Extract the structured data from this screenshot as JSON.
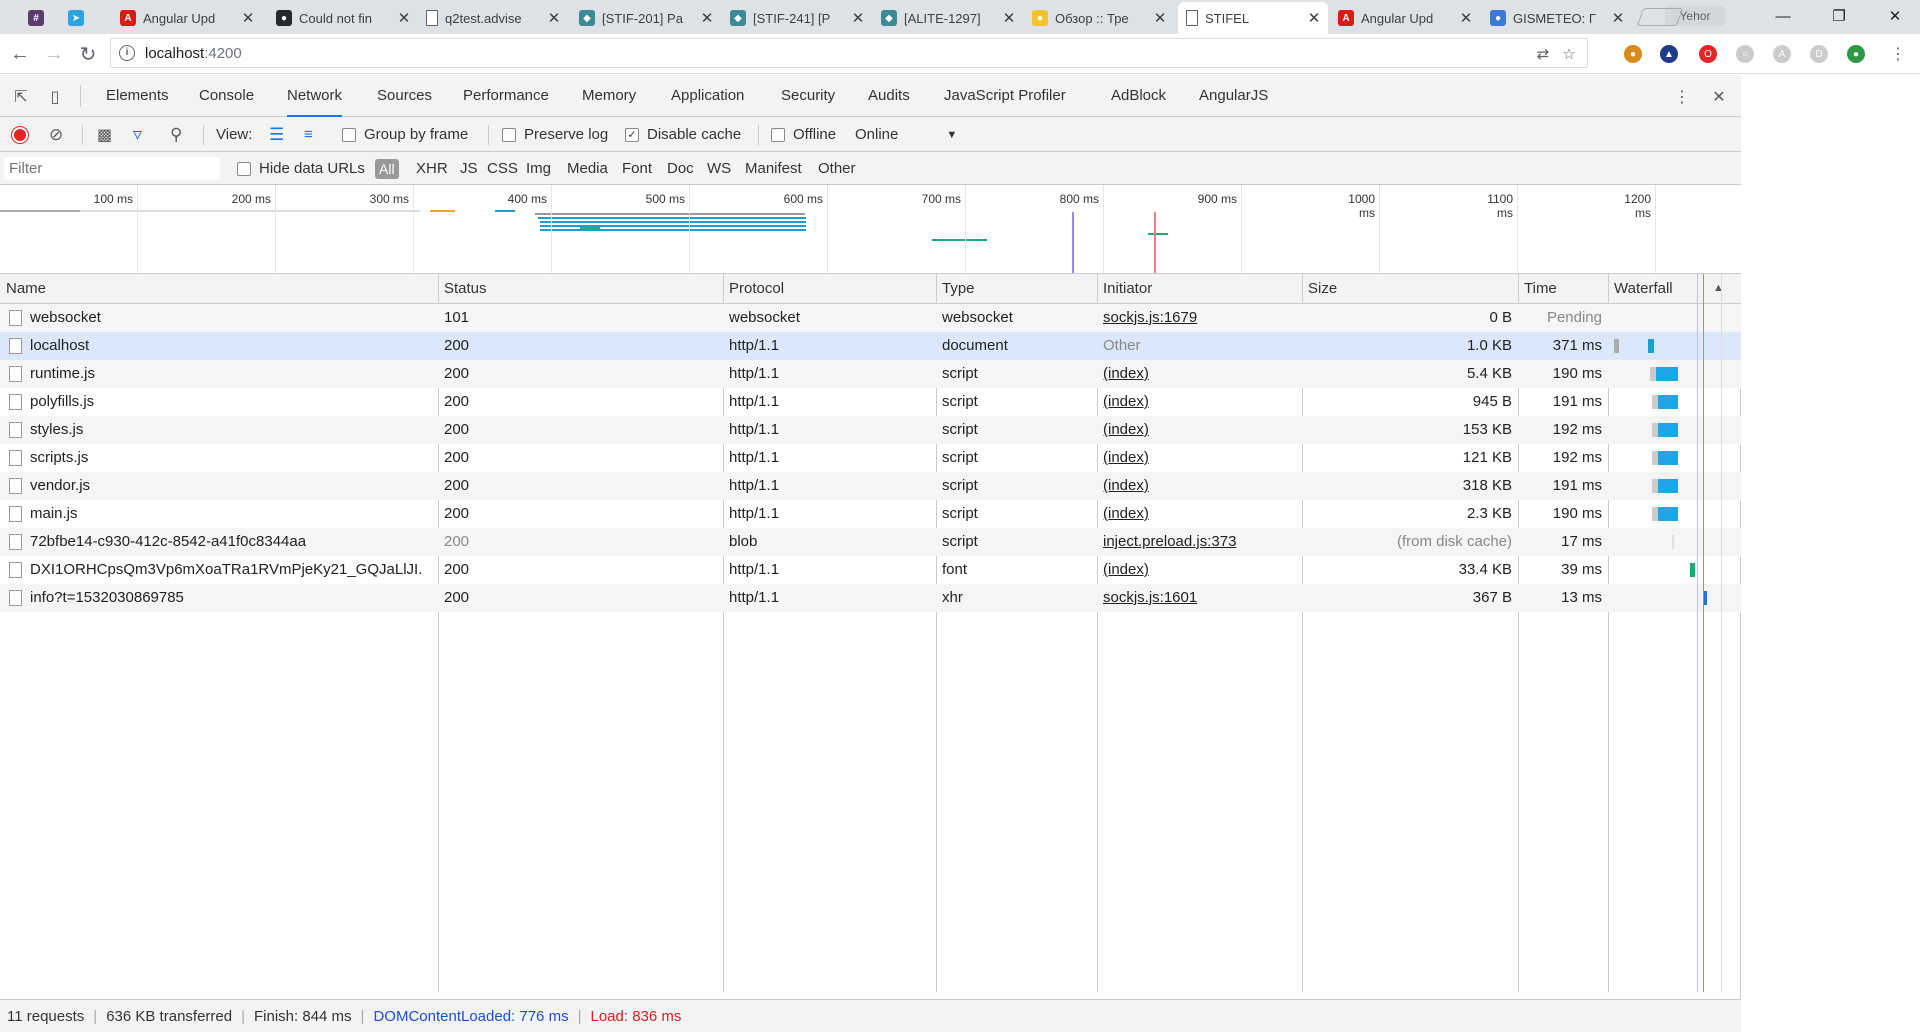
{
  "browser": {
    "tabs": [
      {
        "title": "",
        "fav": "#",
        "favColor": "#5b3b6e"
      },
      {
        "title": "",
        "fav": "➤",
        "favColor": "#2aa3e0"
      },
      {
        "title": "Angular Upd",
        "fav": "A",
        "favColor": "#dd1b16"
      },
      {
        "title": "Could not fin",
        "fav": "●",
        "favColor": "#24292e"
      },
      {
        "title": "q2test.advise",
        "fav": "",
        "favColor": "#fff"
      },
      {
        "title": "[STIF-201] Pa",
        "fav": "◆",
        "favColor": "#3c8a95"
      },
      {
        "title": "[STIF-241] [P",
        "fav": "◆",
        "favColor": "#3c8a95"
      },
      {
        "title": "[ALITE-1297]",
        "fav": "◆",
        "favColor": "#3c8a95"
      },
      {
        "title": "Обзор :: Тре",
        "fav": "●",
        "favColor": "#f2c232"
      },
      {
        "title": "STIFEL",
        "fav": "",
        "favColor": "#fff"
      },
      {
        "title": "Angular Upd",
        "fav": "A",
        "favColor": "#dd1b16"
      },
      {
        "title": "GISMETEO: Г",
        "fav": "●",
        "favColor": "#3a7bd5"
      }
    ],
    "user": "Yehor",
    "url_host": "localhost",
    "url_port": ":4200"
  },
  "devtools": {
    "tabs": [
      "Elements",
      "Console",
      "Network",
      "Sources",
      "Performance",
      "Memory",
      "Application",
      "Security",
      "Audits",
      "JavaScript Profiler",
      "AdBlock",
      "AngularJS"
    ],
    "toolbar": {
      "view_label": "View:",
      "group_by_frame": "Group by frame",
      "preserve_log": "Preserve log",
      "disable_cache": "Disable cache",
      "offline": "Offline",
      "throttle": "Online"
    },
    "filter": {
      "placeholder": "Filter",
      "hide_data_urls": "Hide data URLs",
      "types": [
        "All",
        "XHR",
        "JS",
        "CSS",
        "Img",
        "Media",
        "Font",
        "Doc",
        "WS",
        "Manifest",
        "Other"
      ]
    },
    "overview_ticks": [
      "100 ms",
      "200 ms",
      "300 ms",
      "400 ms",
      "500 ms",
      "600 ms",
      "700 ms",
      "800 ms",
      "900 ms",
      "1000 ms",
      "1100 ms",
      "1200 ms"
    ],
    "columns": [
      "Name",
      "Status",
      "Protocol",
      "Type",
      "Initiator",
      "Size",
      "Time",
      "Waterfall"
    ],
    "rows": [
      {
        "name": "websocket",
        "status": "101",
        "protocol": "websocket",
        "type": "websocket",
        "initiator": "sockjs.js:1679",
        "init_link": true,
        "size": "0 B",
        "time": "Pending",
        "time_dim": true
      },
      {
        "name": "localhost",
        "status": "200",
        "protocol": "http/1.1",
        "type": "document",
        "initiator": "Other",
        "init_link": false,
        "size": "1.0 KB",
        "time": "371 ms"
      },
      {
        "name": "runtime.js",
        "status": "200",
        "protocol": "http/1.1",
        "type": "script",
        "initiator": "(index)",
        "init_link": true,
        "size": "5.4 KB",
        "time": "190 ms"
      },
      {
        "name": "polyfills.js",
        "status": "200",
        "protocol": "http/1.1",
        "type": "script",
        "initiator": "(index)",
        "init_link": true,
        "size": "945 B",
        "time": "191 ms"
      },
      {
        "name": "styles.js",
        "status": "200",
        "protocol": "http/1.1",
        "type": "script",
        "initiator": "(index)",
        "init_link": true,
        "size": "153 KB",
        "time": "192 ms"
      },
      {
        "name": "scripts.js",
        "status": "200",
        "protocol": "http/1.1",
        "type": "script",
        "initiator": "(index)",
        "init_link": true,
        "size": "121 KB",
        "time": "192 ms"
      },
      {
        "name": "vendor.js",
        "status": "200",
        "protocol": "http/1.1",
        "type": "script",
        "initiator": "(index)",
        "init_link": true,
        "size": "318 KB",
        "time": "191 ms"
      },
      {
        "name": "main.js",
        "status": "200",
        "protocol": "http/1.1",
        "type": "script",
        "initiator": "(index)",
        "init_link": true,
        "size": "2.3 KB",
        "time": "190 ms"
      },
      {
        "name": "72bfbe14-c930-412c-8542-a41f0c8344aa",
        "status": "200",
        "status_dim": true,
        "protocol": "blob",
        "type": "script",
        "initiator": "inject.preload.js:373",
        "init_link": true,
        "size": "(from disk cache)",
        "size_dim": true,
        "time": "17 ms"
      },
      {
        "name": "DXI1ORHCpsQm3Vp6mXoaTRa1RVmPjeKy21_GQJaLlJI....",
        "status": "200",
        "protocol": "http/1.1",
        "type": "font",
        "initiator": "(index)",
        "init_link": true,
        "size": "33.4 KB",
        "time": "39 ms"
      },
      {
        "name": "info?t=1532030869785",
        "status": "200",
        "protocol": "http/1.1",
        "type": "xhr",
        "initiator": "sockjs.js:1601",
        "init_link": true,
        "size": "367 B",
        "time": "13 ms"
      }
    ],
    "status": {
      "requests": "11 requests",
      "transferred": "636 KB transferred",
      "finish": "Finish: 844 ms",
      "dcl": "DOMContentLoaded: 776 ms",
      "load": "Load: 836 ms"
    }
  }
}
